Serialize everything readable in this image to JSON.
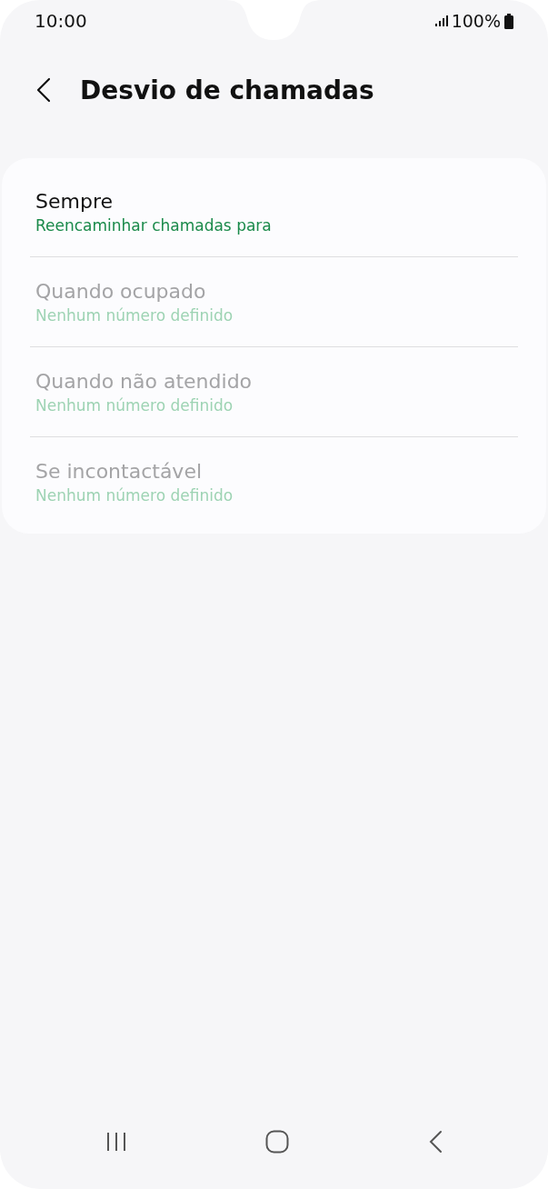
{
  "status_bar": {
    "time": "10:00",
    "battery": "100%"
  },
  "header": {
    "title": "Desvio de chamadas"
  },
  "items": [
    {
      "title": "Sempre",
      "summary": "Reencaminhar chamadas para",
      "disabled": false
    },
    {
      "title": "Quando ocupado",
      "summary": "Nenhum número definido",
      "disabled": true
    },
    {
      "title": "Quando não atendido",
      "summary": "Nenhum número definido",
      "disabled": true
    },
    {
      "title": "Se incontactável",
      "summary": "Nenhum número definido",
      "disabled": true
    }
  ]
}
